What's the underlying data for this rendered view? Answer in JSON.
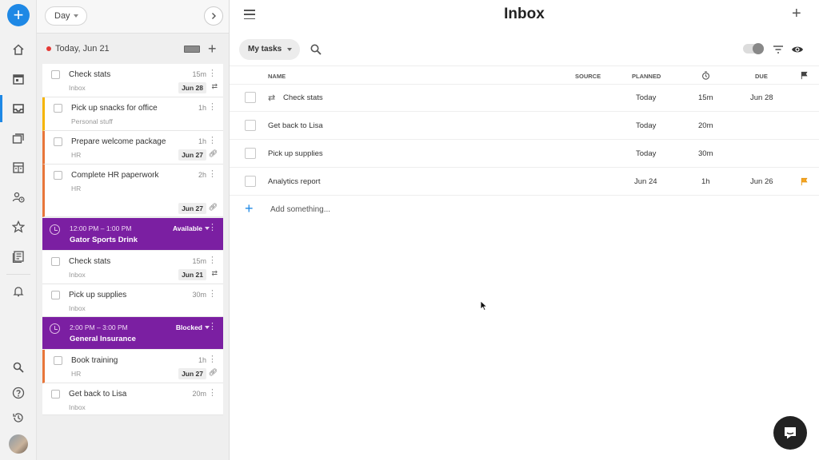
{
  "rail": {
    "add_button": "+",
    "icons": [
      "home-icon",
      "calendar-icon",
      "inbox-icon",
      "projects-icon",
      "board-icon",
      "people-icon",
      "star-icon",
      "reports-icon",
      "bell-icon",
      "search-icon",
      "help-icon",
      "history-icon"
    ]
  },
  "day": {
    "view_label": "Day",
    "date_label": "Today, Jun 21",
    "cards": [
      {
        "title": "Check stats",
        "sub": "Inbox",
        "dur": "15m",
        "chip": "Jun 28"
      },
      {
        "title": "Pick up snacks for office",
        "sub": "Personal stuff",
        "dur": "1h"
      },
      {
        "title": "Prepare welcome package",
        "sub": "HR",
        "dur": "1h",
        "chip": "Jun 27"
      },
      {
        "title": "Complete HR paperwork",
        "sub": "HR",
        "dur": "2h",
        "chip": "Jun 27"
      },
      {
        "title": "Check stats",
        "sub": "Inbox",
        "dur": "15m",
        "chip": "Jun 21"
      },
      {
        "title": "Pick up supplies",
        "sub": "Inbox",
        "dur": "30m"
      },
      {
        "title": "Book training",
        "sub": "HR",
        "dur": "1h",
        "chip": "Jun 27"
      },
      {
        "title": "Get back to Lisa",
        "sub": "Inbox",
        "dur": "20m"
      }
    ],
    "events": [
      {
        "time": "12:00 PM – 1:00 PM",
        "name": "Gator Sports Drink",
        "status": "Available"
      },
      {
        "time": "2:00 PM – 3:00 PM",
        "name": "General Insurance",
        "status": "Blocked"
      }
    ]
  },
  "main": {
    "title": "Inbox",
    "filter_label": "My tasks",
    "columns": {
      "name": "NAME",
      "source": "SOURCE",
      "planned": "PLANNED",
      "due": "DUE"
    },
    "rows": [
      {
        "name": "Check stats",
        "planned": "Today",
        "time": "15m",
        "due": "Jun 28"
      },
      {
        "name": "Get back to Lisa",
        "planned": "Today",
        "time": "20m",
        "due": ""
      },
      {
        "name": "Pick up supplies",
        "planned": "Today",
        "time": "30m",
        "due": ""
      },
      {
        "name": "Analytics report",
        "planned": "Jun 24",
        "time": "1h",
        "due": "Jun 26"
      }
    ],
    "add_placeholder": "Add something..."
  },
  "colors": {
    "accent": "#1e88e5",
    "event": "#7b1fa2",
    "flag": "#f5a623",
    "yellow_bar": "#f5b400",
    "orange_bar": "#e8763a"
  }
}
